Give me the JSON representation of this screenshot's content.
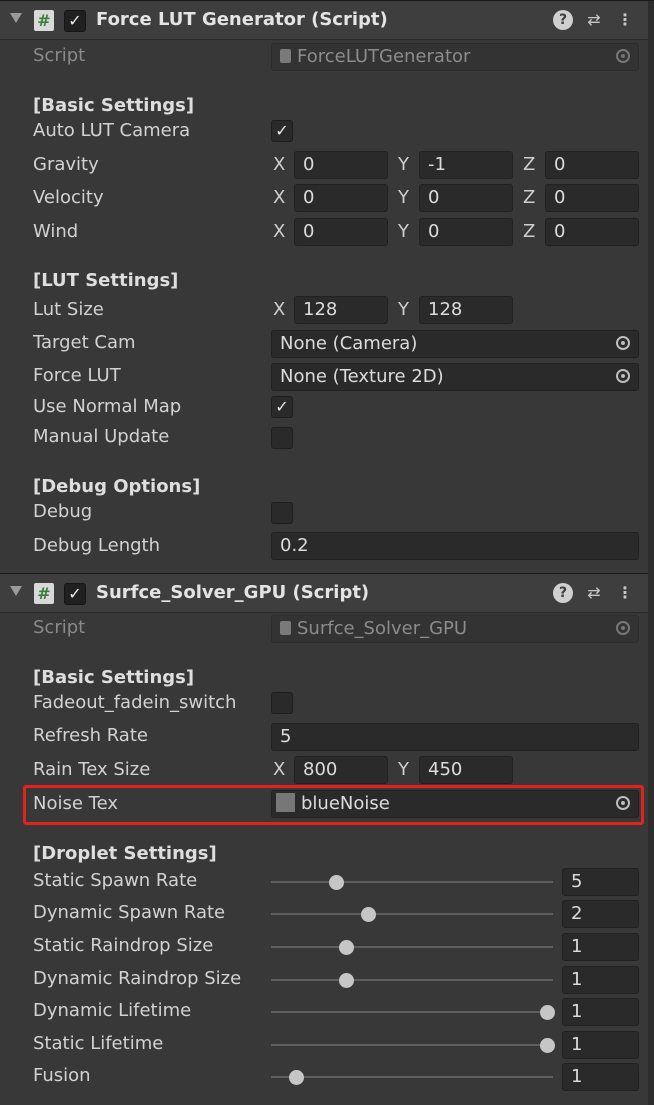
{
  "components": [
    {
      "title": "Force LUT Generator (Script)",
      "script_label": "Script",
      "script_value": "ForceLUTGenerator",
      "sections": {
        "basic": "[Basic Settings]",
        "lut": "[LUT Settings]",
        "debug": "[Debug Options]"
      },
      "fields": {
        "auto_lut_camera": {
          "label": "Auto LUT Camera",
          "checked": true
        },
        "gravity": {
          "label": "Gravity",
          "x": "0",
          "y": "-1",
          "z": "0"
        },
        "velocity": {
          "label": "Velocity",
          "x": "0",
          "y": "0",
          "z": "0"
        },
        "wind": {
          "label": "Wind",
          "x": "0",
          "y": "0",
          "z": "0"
        },
        "lut_size": {
          "label": "Lut Size",
          "x": "128",
          "y": "128"
        },
        "target_cam": {
          "label": "Target Cam",
          "value": "None (Camera)"
        },
        "force_lut": {
          "label": "Force LUT",
          "value": "None (Texture 2D)"
        },
        "use_normal_map": {
          "label": "Use Normal Map",
          "checked": true
        },
        "manual_update": {
          "label": "Manual Update",
          "checked": false
        },
        "debug": {
          "label": "Debug",
          "checked": false
        },
        "debug_length": {
          "label": "Debug Length",
          "value": "0.2"
        }
      }
    },
    {
      "title": "Surfce_Solver_GPU (Script)",
      "script_label": "Script",
      "script_value": "Surfce_Solver_GPU",
      "sections": {
        "basic": "[Basic Settings]",
        "droplet": "[Droplet Settings]"
      },
      "fields": {
        "fadeout_switch": {
          "label": "Fadeout_fadein_switch",
          "checked": false
        },
        "refresh_rate": {
          "label": "Refresh Rate",
          "value": "5"
        },
        "rain_tex_size": {
          "label": "Rain Tex Size",
          "x": "800",
          "y": "450"
        },
        "noise_tex": {
          "label": "Noise Tex",
          "value": "blueNoise"
        }
      },
      "sliders": [
        {
          "label": "Static Spawn Rate",
          "value": "5",
          "fraction": 0.23
        },
        {
          "label": "Dynamic Spawn Rate",
          "value": "2",
          "fraction": 0.345
        },
        {
          "label": "Static Raindrop Size",
          "value": "1",
          "fraction": 0.265
        },
        {
          "label": "Dynamic Raindrop Size",
          "value": "1",
          "fraction": 0.265
        },
        {
          "label": "Dynamic Lifetime",
          "value": "1",
          "fraction": 0.98
        },
        {
          "label": "Static Lifetime",
          "value": "1",
          "fraction": 0.98
        },
        {
          "label": "Fusion",
          "value": "1",
          "fraction": 0.09
        }
      ]
    }
  ],
  "axes": {
    "x": "X",
    "y": "Y",
    "z": "Z"
  },
  "icons": {
    "help": "?",
    "preset": "⇄",
    "more": "⋮",
    "check": "✓",
    "hash": "#"
  }
}
